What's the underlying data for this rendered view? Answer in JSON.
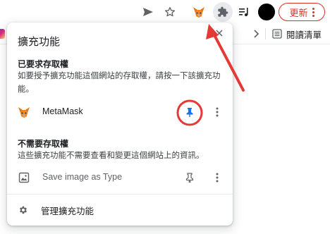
{
  "toolbar": {
    "icons": [
      "send-icon",
      "star-icon",
      "metamask-icon",
      "puzzle-icon",
      "media-queue-icon",
      "profile-avatar",
      "more-icon"
    ],
    "update_label": "更新"
  },
  "bookmarks": {
    "reading_list_label": "閱讀清單"
  },
  "popup": {
    "title": "擴充功能",
    "access_section": {
      "heading": "已要求存取權",
      "description": "如要授予擴充功能這個網站的存取權，請按一下該擴充功能。",
      "extension": {
        "name": "MetaMask",
        "pinned": true,
        "pin_color": "#1a73e8"
      }
    },
    "no_access_section": {
      "heading": "不需要存取權",
      "description": "這些擴充功能不需要查看和變更這個網站上的資訊。",
      "extension": {
        "name": "Save image as Type",
        "pinned": false
      }
    },
    "manage_label": "管理擴充功能"
  },
  "annotation": {
    "color": "#e53935"
  }
}
